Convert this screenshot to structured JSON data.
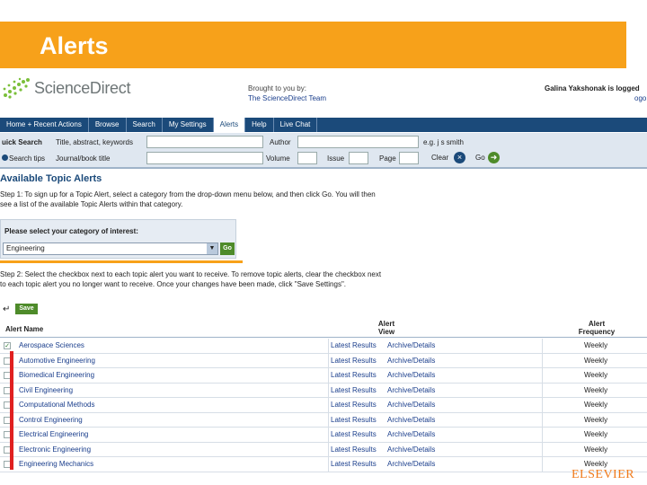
{
  "slide": {
    "title": "Alerts"
  },
  "header": {
    "logo_text": "ScienceDirect",
    "brought_line": "Brought to you by:",
    "brought_team": "The ScienceDirect Team",
    "user_line": "Galina Yakshonak is logged",
    "user_link": "ogo"
  },
  "nav": {
    "items": [
      {
        "label": "Home + Recent Actions"
      },
      {
        "label": "Browse"
      },
      {
        "label": "Search"
      },
      {
        "label": "My Settings"
      },
      {
        "label": "Alerts"
      },
      {
        "label": "Help"
      },
      {
        "label": "Live Chat"
      }
    ]
  },
  "search": {
    "quick_label": "uick Search",
    "title_label": "Title, abstract, keywords",
    "author_label": "Author",
    "example": "e.g. j s smith",
    "search_tips": "Search tips",
    "journal_label": "Journal/book title",
    "volume_label": "Volume",
    "issue_label": "Issue",
    "page_label": "Page",
    "clear_label": "Clear",
    "go_label": "Go"
  },
  "topic": {
    "heading": "Available Topic Alerts",
    "step1_line1": "Step 1: To sign up for a Topic Alert, select a category from the drop-down menu below, and then click Go. You will then",
    "step1_line2": "see a list of the available Topic Alerts within that category.",
    "category_prompt": "Please select your category of interest:",
    "category_value": "Engineering",
    "go_button": "Go",
    "step2_line1": "Step 2: Select the checkbox next to each topic alert you want to receive. To remove topic alerts, clear the checkbox next",
    "step2_line2": "to each topic alert you no longer want to receive. Once your changes have been made, click \"Save Settings\"."
  },
  "table": {
    "save_label": "Save",
    "col_name": "Alert Name",
    "col_view_1": "Alert",
    "col_view_2": "View",
    "col_freq_1": "Alert",
    "col_freq_2": "Frequency",
    "rows": [
      {
        "name": "Aerospace Sciences",
        "latest": "Latest Results",
        "archive": "Archive/Details",
        "freq": "Weekly",
        "checked": "✓"
      },
      {
        "name": "Automotive Engineering",
        "latest": "Latest Results",
        "archive": "Archive/Details",
        "freq": "Weekly",
        "checked": ""
      },
      {
        "name": "Biomedical Engineering",
        "latest": "Latest Results",
        "archive": "Archive/Details",
        "freq": "Weekly",
        "checked": ""
      },
      {
        "name": "Civil Engineering",
        "latest": "Latest Results",
        "archive": "Archive/Details",
        "freq": "Weekly",
        "checked": ""
      },
      {
        "name": "Computational Methods",
        "latest": "Latest Results",
        "archive": "Archive/Details",
        "freq": "Weekly",
        "checked": ""
      },
      {
        "name": "Control Engineering",
        "latest": "Latest Results",
        "archive": "Archive/Details",
        "freq": "Weekly",
        "checked": ""
      },
      {
        "name": "Electrical Engineering",
        "latest": "Latest Results",
        "archive": "Archive/Details",
        "freq": "Weekly",
        "checked": ""
      },
      {
        "name": "Electronic Engineering",
        "latest": "Latest Results",
        "archive": "Archive/Details",
        "freq": "Weekly",
        "checked": ""
      },
      {
        "name": "Engineering Mechanics",
        "latest": "Latest Results",
        "archive": "Archive/Details",
        "freq": "Weekly",
        "checked": ""
      }
    ]
  },
  "footer": {
    "publisher": "ELSEVIER"
  },
  "colors": {
    "accent_orange": "#f7a11a",
    "nav_blue": "#1b4a7a",
    "link_blue": "#1a3e8c",
    "highlight_red": "#e02020"
  }
}
